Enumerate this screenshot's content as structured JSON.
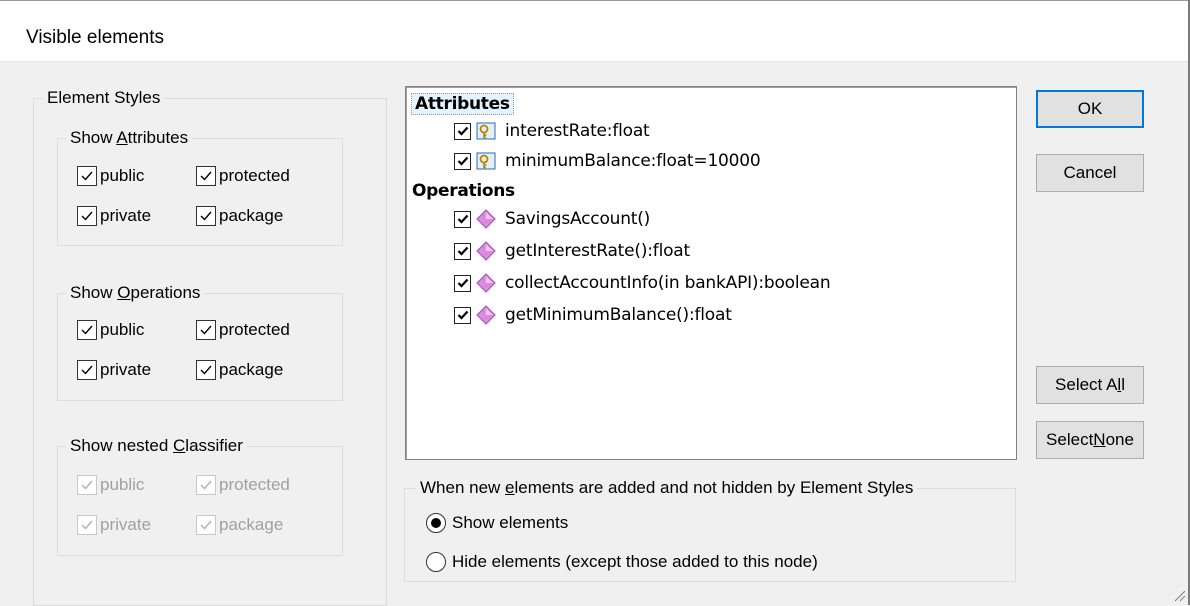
{
  "window": {
    "title": "Visible elements"
  },
  "element_styles": {
    "label": "Element Styles",
    "show_attributes": {
      "label_pre": "Show ",
      "label_u": "A",
      "label_post": "ttributes",
      "public": "public",
      "protected": "protected",
      "private": "private",
      "package": "package"
    },
    "show_operations": {
      "label_pre": "Show ",
      "label_u": "O",
      "label_post": "perations",
      "public": "public",
      "protected": "protected",
      "private": "private",
      "package": "package"
    },
    "show_nested": {
      "label_pre": "Show nested ",
      "label_u": "C",
      "label_post": "lassifier",
      "public": "public",
      "protected": "protected",
      "private": "private",
      "package": "package"
    }
  },
  "list": {
    "attributes_header": "Attributes",
    "attributes": [
      "interestRate:float",
      "minimumBalance:float=10000"
    ],
    "operations_header": "Operations",
    "operations": [
      "SavingsAccount()",
      "getInterestRate():float",
      "collectAccountInfo(in bankAPI):boolean",
      "getMinimumBalance():float"
    ]
  },
  "new_elements": {
    "label_pre": "When new ",
    "label_u": "e",
    "label_post": "lements are added and not hidden by Element Styles",
    "show": "Show elements",
    "hide": "Hide elements (except those added to this node)",
    "selected": "show"
  },
  "buttons": {
    "ok": "OK",
    "cancel": "Cancel",
    "select_all_pre": "Select A",
    "select_all_u": "l",
    "select_all_post": "l",
    "select_none_pre": "Select ",
    "select_none_u": "N",
    "select_none_post": "one"
  },
  "colors": {
    "accent": "#0078d7",
    "operation_icon": "#d98be0",
    "attribute_icon": "#1e6fb8"
  },
  "icons": {
    "attribute": "key-attribute-icon",
    "operation": "diamond-operation-icon"
  }
}
